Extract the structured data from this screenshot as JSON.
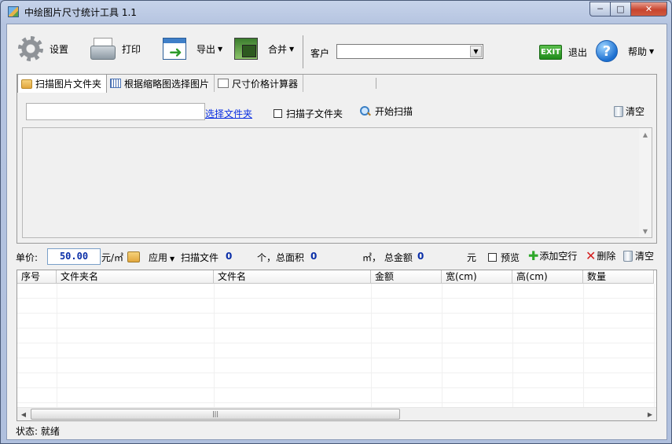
{
  "window": {
    "title": "中绘图片尺寸统计工具 1.1",
    "icons": [
      "app-icon",
      "minimize-icon",
      "maximize-icon",
      "close-icon"
    ]
  },
  "toolbar": {
    "settings_label": "设置",
    "print_label": "打印",
    "export_label": "导出",
    "merge_label": "合并",
    "customer_label": "客户",
    "customer_value": "",
    "exit_label": "退出",
    "exit_icon_text": "EXIT",
    "help_label": "帮助",
    "help_icon_text": "?"
  },
  "tabs": [
    {
      "label": "扫描图片文件夹",
      "active": true,
      "icon": "folder-icon"
    },
    {
      "label": "根据缩略图选择图片",
      "active": false,
      "icon": "grid-icon"
    },
    {
      "label": "尺寸价格计算器",
      "active": false,
      "icon": "card-icon"
    }
  ],
  "scan_panel": {
    "folder_path": "",
    "select_folder_label": "选择文件夹",
    "scan_subfolders_label": "扫描子文件夹",
    "scan_subfolders_checked": false,
    "start_scan_label": "开始扫描",
    "clear_label": "清空"
  },
  "price_bar": {
    "unit_price_label": "单价:",
    "unit_price_value": "50.00",
    "unit_label": "元/㎡",
    "apply_label": "应用",
    "scanned_files_label": "扫描文件",
    "file_count": "0",
    "total_area_label": "个，总面积",
    "total_area": "0",
    "total_amount_label": "㎡，  总金额",
    "total_amount": "0",
    "currency_label": "元",
    "preview_label": "预览",
    "preview_checked": false,
    "add_row_label": "添加空行",
    "delete_label": "删除",
    "clear_label": "清空"
  },
  "grid": {
    "columns": [
      "序号",
      "文件夹名",
      "文件名",
      "金额",
      "宽(cm)",
      "高(cm)",
      "数量"
    ],
    "rows": []
  },
  "status": {
    "text": "状态: 就绪"
  }
}
